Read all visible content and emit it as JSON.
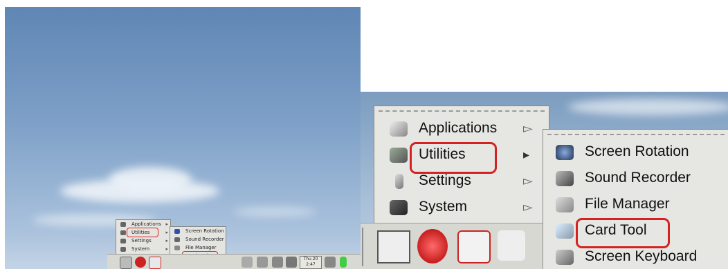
{
  "menu": {
    "items": [
      {
        "label": "Applications",
        "icon": "applications-icon",
        "has_submenu": true
      },
      {
        "label": "Utilities",
        "icon": "utilities-icon",
        "has_submenu": true,
        "highlighted": true
      },
      {
        "label": "Settings",
        "icon": "settings-icon",
        "has_submenu": true
      },
      {
        "label": "System",
        "icon": "system-icon",
        "has_submenu": true
      }
    ]
  },
  "submenu": {
    "items": [
      {
        "label": "Screen Rotation",
        "icon": "screen-rotation-icon"
      },
      {
        "label": "Sound Recorder",
        "icon": "sound-recorder-icon"
      },
      {
        "label": "File Manager",
        "icon": "file-manager-icon"
      },
      {
        "label": "Card Tool",
        "icon": "card-tool-icon",
        "highlighted": true
      },
      {
        "label": "Screen Keyboard",
        "icon": "screen-keyboard-icon"
      }
    ]
  },
  "taskbar": {
    "clock_day": "Thu 20",
    "clock_time": "2:47"
  },
  "colors": {
    "highlight": "#d42222",
    "menu_bg": "#e6e6e2",
    "sky": "#7fa1c8"
  }
}
